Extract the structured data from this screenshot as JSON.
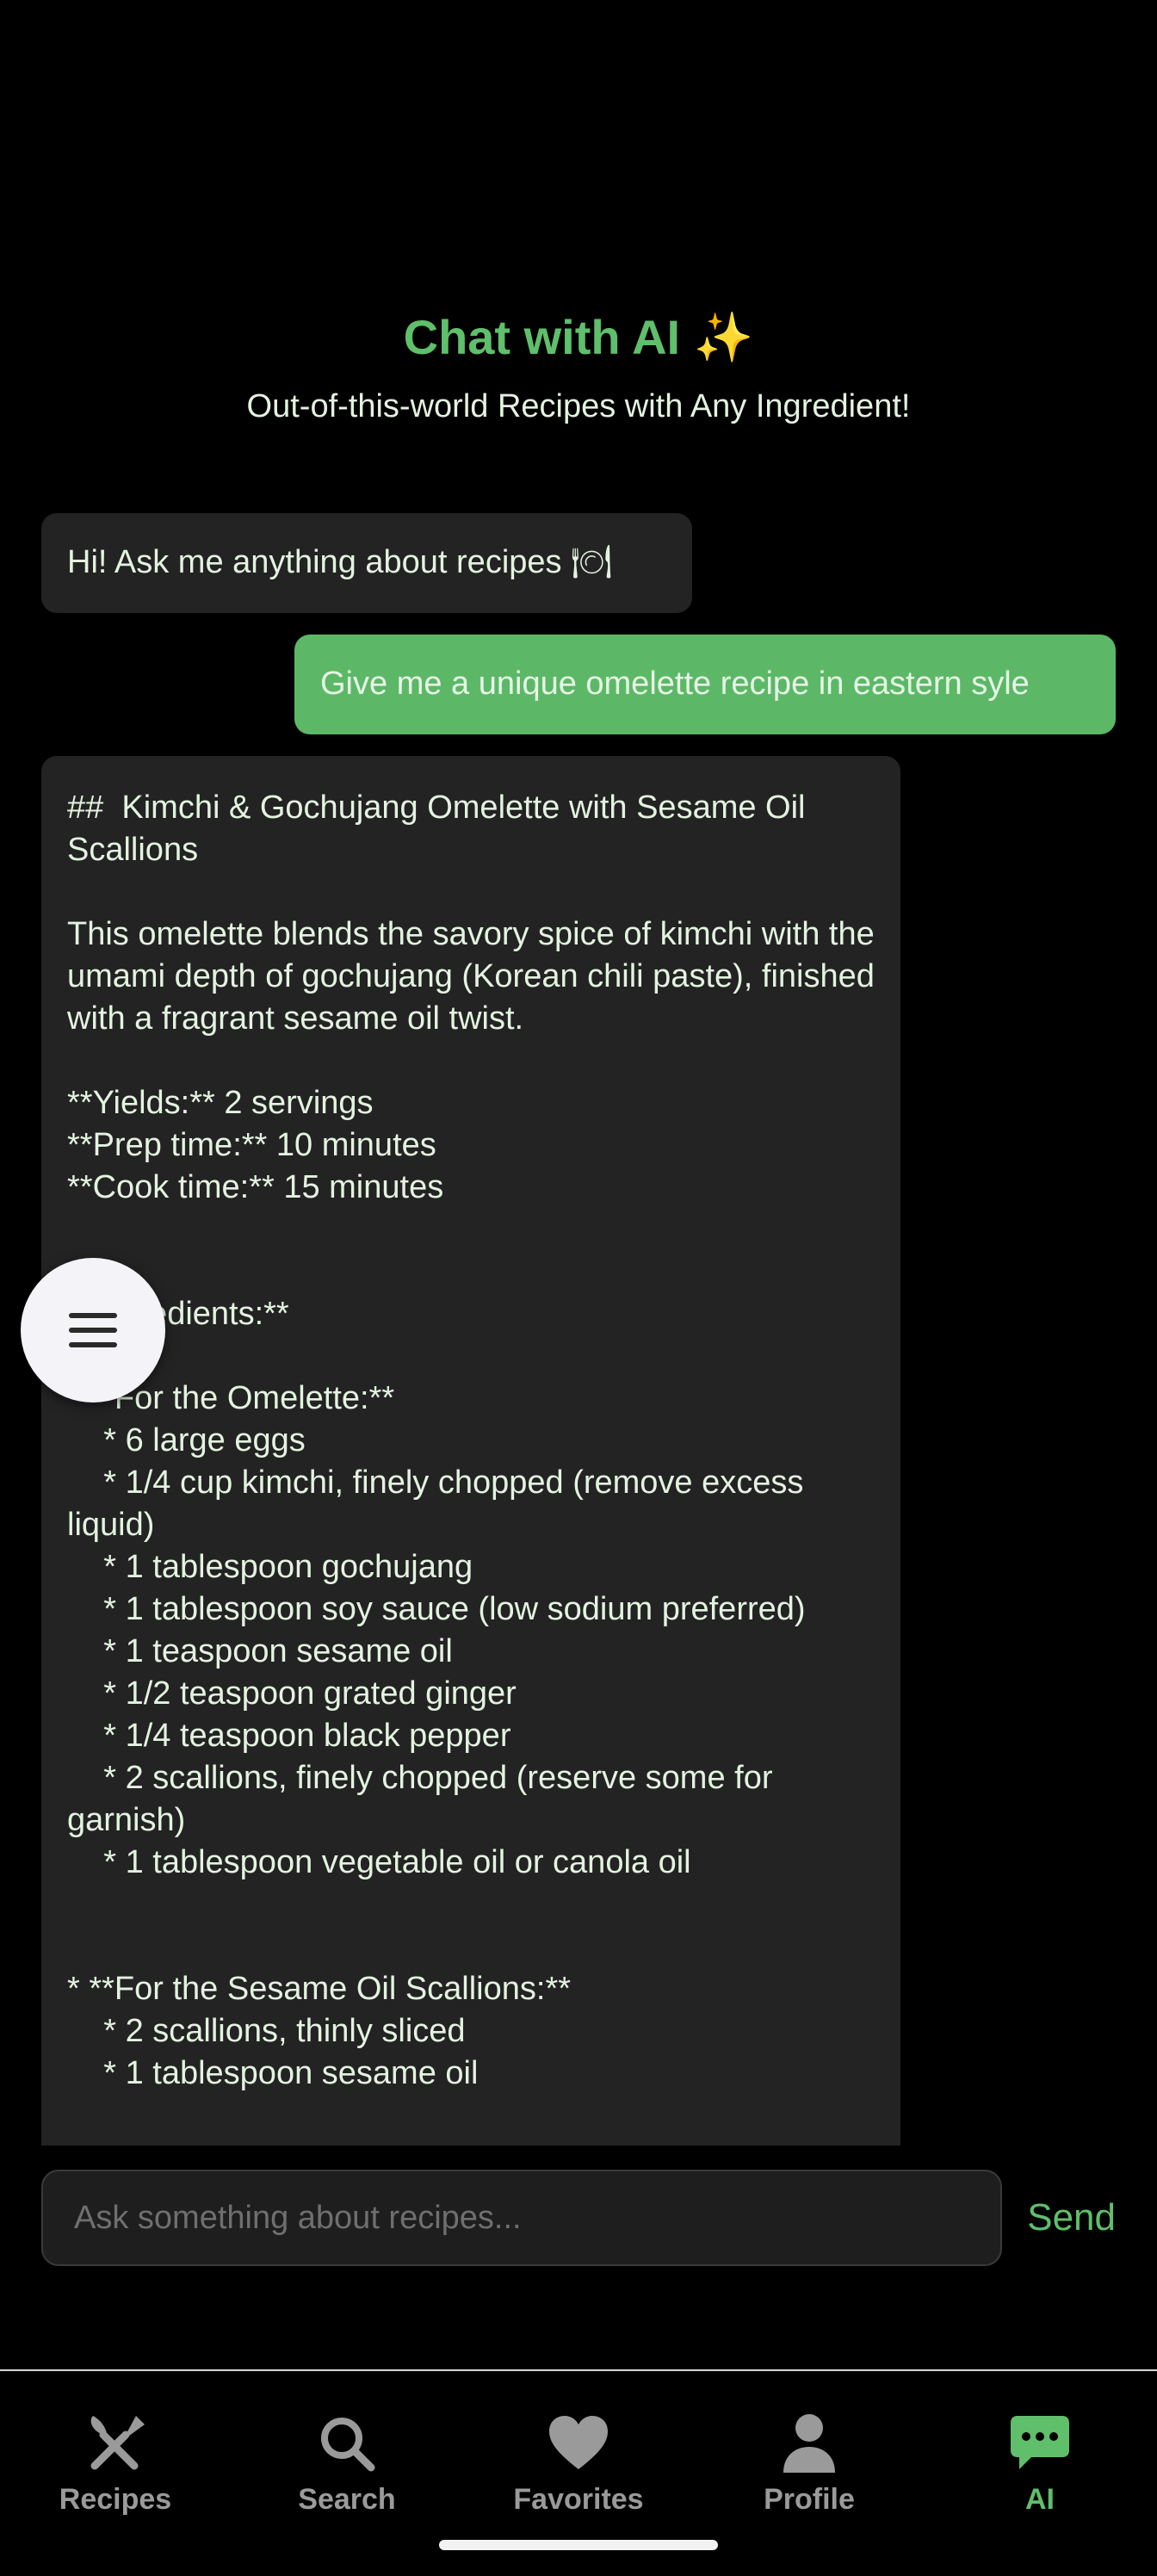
{
  "header": {
    "title": "Chat with AI ✨",
    "subtitle": "Out-of-this-world Recipes with Any Ingredient!"
  },
  "chat": {
    "greeting": "Hi! Ask me anything about recipes 🍽",
    "user_message": "Give me a unique omelette recipe in eastern syle",
    "recipe_response": "##  Kimchi & Gochujang Omelette with Sesame Oil Scallions\n\nThis omelette blends the savory spice of kimchi with the umami depth of gochujang (Korean chili paste), finished with a fragrant sesame oil twist.\n\n**Yields:** 2 servings\n**Prep time:** 10 minutes\n**Cook time:** 15 minutes\n\n\n**Ingredients:**\n\n* **For the Omelette:**\n    * 6 large eggs\n    * 1/4 cup kimchi, finely chopped (remove excess liquid)\n    * 1 tablespoon gochujang\n    * 1 tablespoon soy sauce (low sodium preferred)\n    * 1 teaspoon sesame oil\n    * 1/2 teaspoon grated ginger\n    * 1/4 teaspoon black pepper\n    * 2 scallions, finely chopped (reserve some for garnish)\n    * 1 tablespoon vegetable oil or canola oil\n\n\n* **For the Sesame Oil Scallions:**\n    * 2 scallions, thinly sliced\n    * 1 tablespoon sesame oil"
  },
  "fab": {
    "icon": "menu-icon"
  },
  "composer": {
    "placeholder": "Ask something about recipes...",
    "value": "",
    "send_label": "Send"
  },
  "nav": {
    "items": [
      {
        "label": "Recipes",
        "icon": "fork-knife-icon"
      },
      {
        "label": "Search",
        "icon": "search-icon"
      },
      {
        "label": "Favorites",
        "icon": "heart-icon"
      },
      {
        "label": "Profile",
        "icon": "person-icon"
      },
      {
        "label": "AI",
        "icon": "chat-icon"
      }
    ],
    "active": "AI"
  },
  "colors": {
    "accent": "#5fbf6b",
    "user_bubble": "#5cb867",
    "bot_bubble": "#232323",
    "background": "#000000"
  }
}
